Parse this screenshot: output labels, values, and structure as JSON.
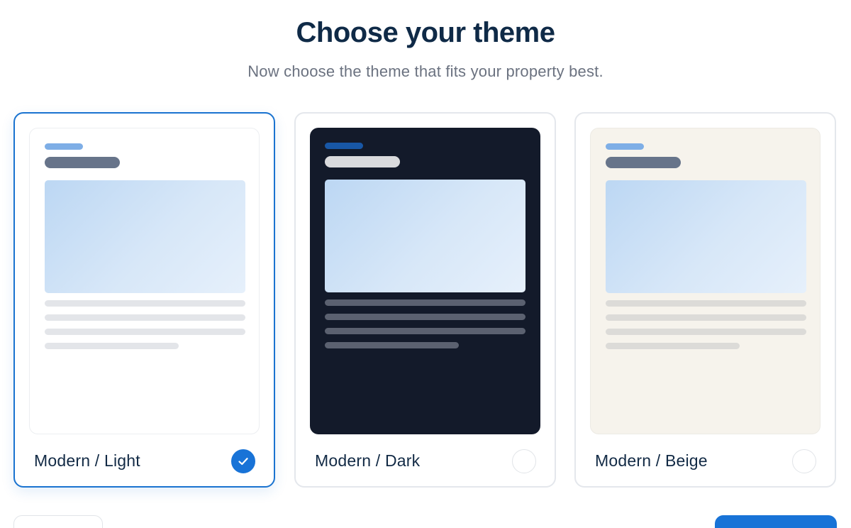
{
  "header": {
    "title": "Choose your theme",
    "subtitle": "Now choose the theme that fits your property best."
  },
  "themes": [
    {
      "label": "Modern / Light",
      "variant": "light",
      "selected": true,
      "preview_bg": "#ffffff"
    },
    {
      "label": "Modern / Dark",
      "variant": "dark",
      "selected": false,
      "preview_bg": "#131a2a"
    },
    {
      "label": "Modern / Beige",
      "variant": "beige",
      "selected": false,
      "preview_bg": "#f6f3ec"
    }
  ],
  "colors": {
    "accent": "#1873d7",
    "title": "#0f2a47",
    "subtitle": "#6b7280",
    "card_border": "#e4e7ec"
  },
  "icons": {
    "selected_check": "check-icon"
  }
}
